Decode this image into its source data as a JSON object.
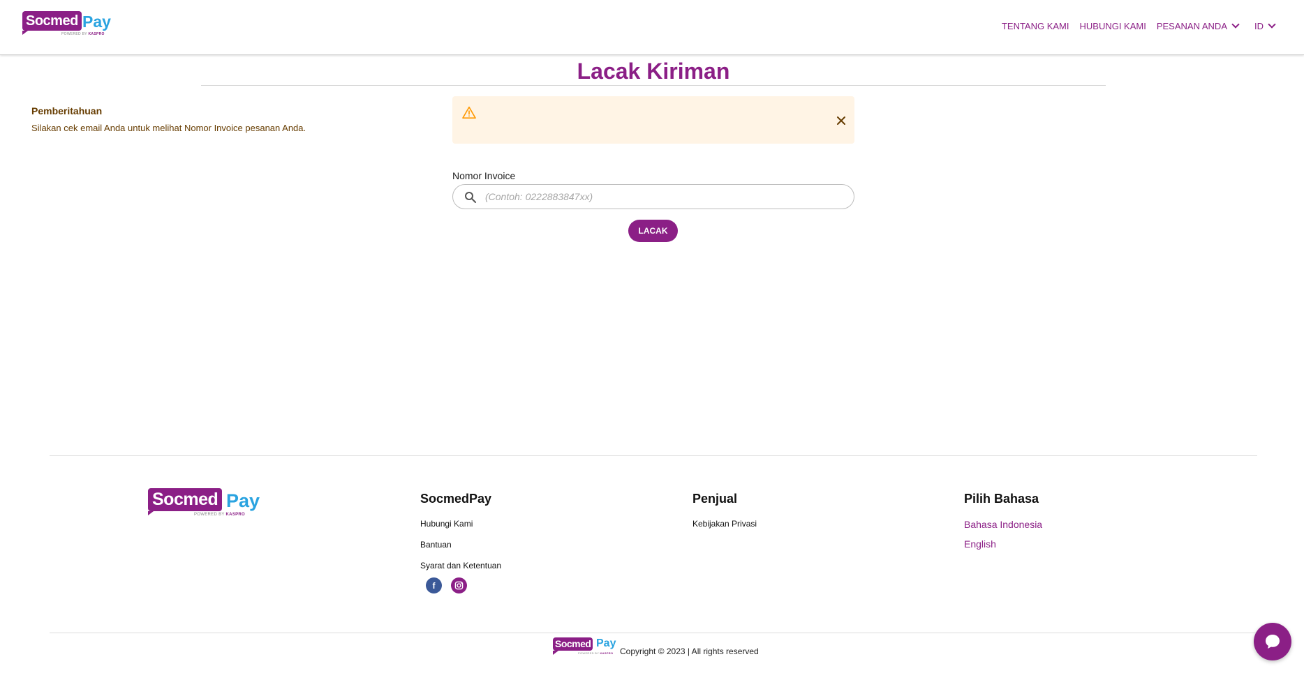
{
  "brand": {
    "name_part1": "Socmed",
    "name_part2": "Pay",
    "powered_by": "POWERED BY",
    "powered_brand": "KASPRO",
    "colors": {
      "primary": "#8b1f86",
      "accent": "#2aa3e0",
      "alert_bg": "#fff4e5",
      "alert_text": "#663c00",
      "alert_icon": "#ff9800"
    }
  },
  "header": {
    "nav": [
      {
        "label": "TENTANG KAMI"
      },
      {
        "label": "HUBUNGI KAMI"
      },
      {
        "label": "PESANAN ANDA",
        "icon": "chevron-down-icon"
      }
    ],
    "language": {
      "label": "ID",
      "icon": "chevron-down-icon"
    }
  },
  "main": {
    "title": "Lacak Kiriman",
    "alert": {
      "icon": "warning-icon",
      "title": "Pemberitahuan",
      "message": "Silakan cek email Anda untuk melihat Nomor Invoice pesanan Anda.",
      "close_icon": "close-icon"
    },
    "invoice": {
      "label": "Nomor Invoice",
      "value": "",
      "placeholder": "(Contoh: 0222883847xx)",
      "icon": "search-icon"
    },
    "track_button": "LACAK"
  },
  "footer": {
    "columns": [
      {
        "heading": "SocmedPay",
        "links": [
          "Hubungi Kami",
          "Bantuan",
          "Syarat dan Ketentuan"
        ]
      },
      {
        "heading": "Penjual",
        "links": [
          "Kebijakan Privasi"
        ]
      },
      {
        "heading": "Pilih Bahasa",
        "links": [
          "Bahasa Indonesia",
          "English"
        ]
      }
    ],
    "socials": [
      {
        "name": "facebook-icon",
        "glyph": "f"
      },
      {
        "name": "instagram-icon"
      }
    ],
    "copyright": "Copyright © 2023 | All rights reserved"
  },
  "chat": {
    "icon": "chat-bubble-icon"
  }
}
